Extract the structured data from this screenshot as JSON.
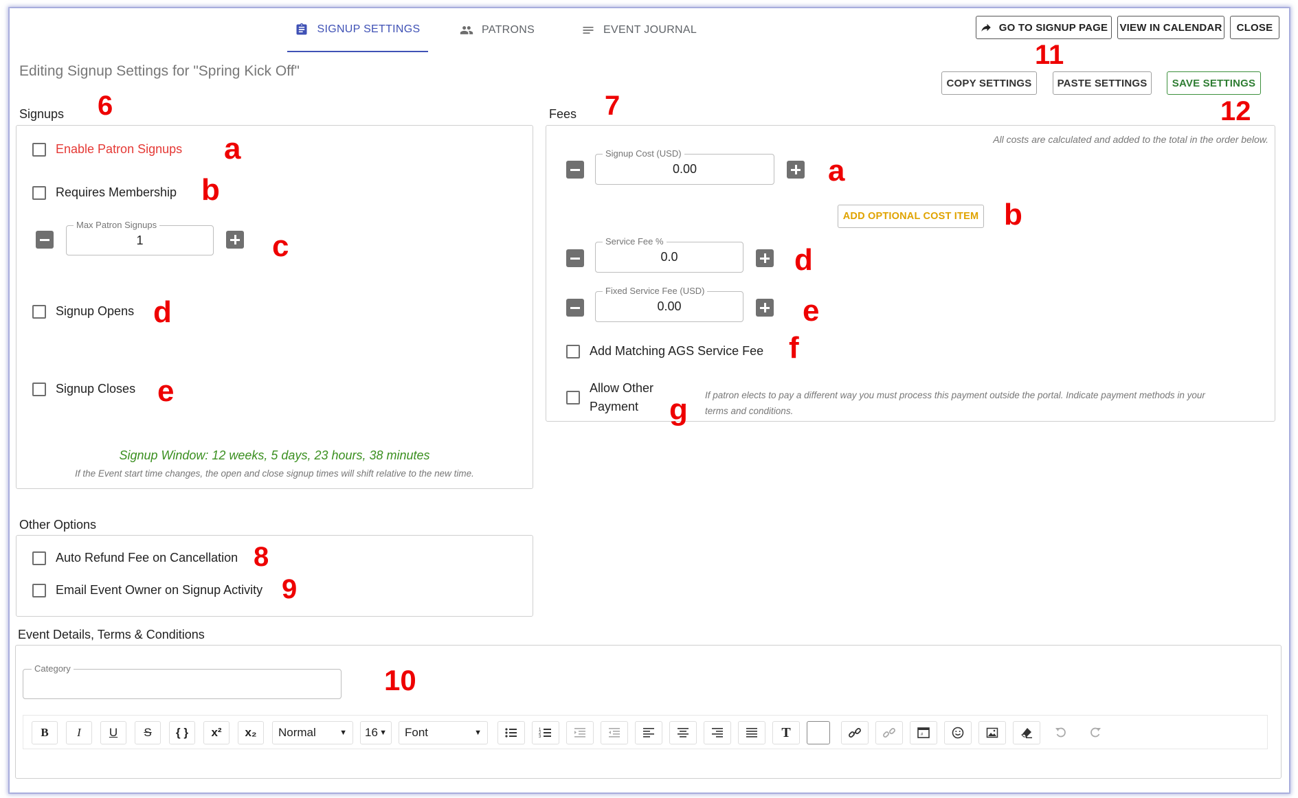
{
  "tabs": [
    {
      "label": "SIGNUP SETTINGS",
      "icon": "clipboard-icon",
      "active": true
    },
    {
      "label": "PATRONS",
      "icon": "people-icon",
      "active": false
    },
    {
      "label": "EVENT JOURNAL",
      "icon": "notes-icon",
      "active": false
    }
  ],
  "top_buttons": {
    "go_to_signup": "GO TO SIGNUP PAGE",
    "view_in_calendar": "VIEW IN CALENDAR",
    "close": "CLOSE"
  },
  "heading": "Editing Signup Settings for \"Spring Kick Off\"",
  "settings_buttons": {
    "copy": "COPY SETTINGS",
    "paste": "PASTE SETTINGS",
    "save": "SAVE SETTINGS"
  },
  "signups": {
    "label": "Signups",
    "enable_patron_signups": "Enable Patron Signups",
    "requires_membership": "Requires Membership",
    "max_patron_signups": {
      "label": "Max Patron Signups",
      "value": "1"
    },
    "signup_opens": "Signup Opens",
    "signup_closes": "Signup Closes",
    "signup_window": "Signup Window: 12 weeks, 5 days, 23 hours, 38 minutes",
    "window_note": "If the Event start time changes, the open and close signup times will shift relative to the new time."
  },
  "fees": {
    "label": "Fees",
    "note": "All costs are calculated and added to the total in the order below.",
    "signup_cost": {
      "label": "Signup Cost (USD)",
      "value": "0.00"
    },
    "add_optional_cost": "ADD OPTIONAL COST ITEM",
    "service_fee": {
      "label": "Service Fee %",
      "value": "0.0"
    },
    "fixed_service_fee": {
      "label": "Fixed Service Fee (USD)",
      "value": "0.00"
    },
    "matching_ags": "Add Matching AGS Service Fee",
    "allow_other_payment_line1": "Allow Other",
    "allow_other_payment_line2": "Payment",
    "other_payment_note_line1": "If patron elects to pay a different way you must process this payment outside the portal. Indicate payment methods in your",
    "other_payment_note_line2": "terms and conditions."
  },
  "other_options": {
    "label": "Other Options",
    "auto_refund": "Auto Refund Fee on Cancellation",
    "email_owner": "Email Event Owner on Signup Activity"
  },
  "event_details": {
    "label": "Event Details, Terms & Conditions",
    "category_label": "Category",
    "category_value": ""
  },
  "toolbar": {
    "bold": "B",
    "italic": "I",
    "underline": "U",
    "strike": "S",
    "code": "{ }",
    "superscript": "x²",
    "subscript": "x₂",
    "format": "Normal",
    "size": "16",
    "font": "Font",
    "text_color": "T"
  },
  "annotations": {
    "n6": "6",
    "n7": "7",
    "n8": "8",
    "n9": "9",
    "n10": "10",
    "n11": "11",
    "n12": "12",
    "s_a": "a",
    "s_b": "b",
    "s_c": "c",
    "s_d": "d",
    "s_e": "e",
    "f_a": "a",
    "f_b": "b",
    "f_d": "d",
    "f_e": "e",
    "f_f": "f",
    "f_g": "g"
  },
  "colors": {
    "accent": "#3f51b5",
    "annotation": "#ee0000",
    "save_green": "#2e7d32",
    "window_green": "#3a8f1f",
    "amber": "#e0a300",
    "enable_red": "#e53935"
  }
}
